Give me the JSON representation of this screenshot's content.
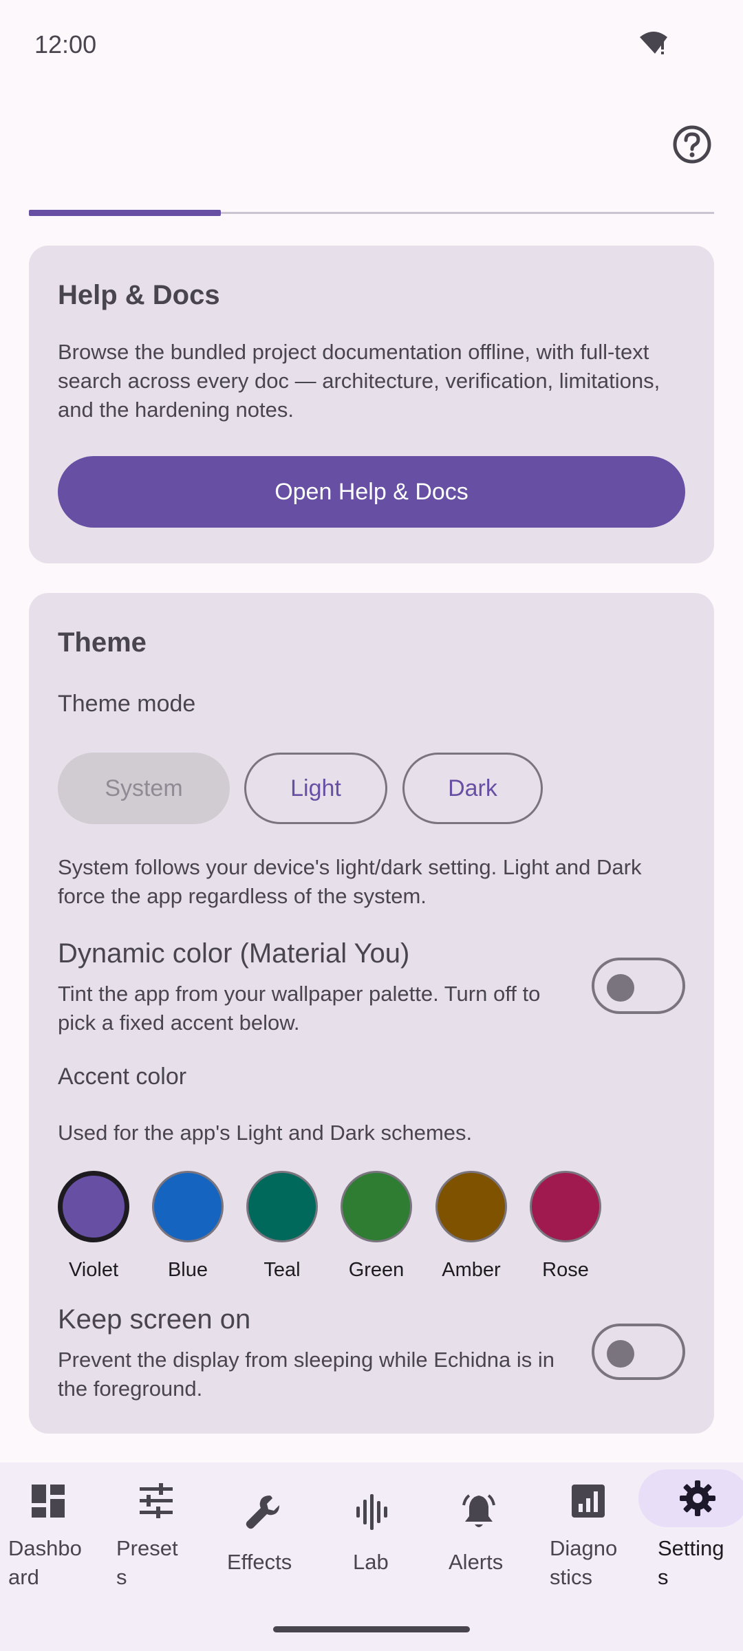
{
  "status_bar": {
    "time": "12:00"
  },
  "progress": {
    "value": 0.28
  },
  "help_card": {
    "title": "Help & Docs",
    "description": "Browse the bundled project documentation offline, with full-text search across every doc — architecture, verification, limitations, and the hardening notes.",
    "button_label": "Open Help & Docs"
  },
  "theme_card": {
    "title": "Theme",
    "mode_label": "Theme mode",
    "modes": [
      "System",
      "Light",
      "Dark"
    ],
    "selected_mode": "System",
    "mode_description": "System follows your device's light/dark setting. Light and Dark force the app regardless of the system.",
    "dynamic_color": {
      "title": "Dynamic color (Material You)",
      "description": "Tint the app from your wallpaper palette. Turn off to pick a fixed accent below.",
      "enabled": false
    },
    "accent": {
      "title": "Accent color",
      "description": "Used for the app's Light and Dark schemes.",
      "selected": "Violet",
      "options": [
        {
          "name": "Violet",
          "color": "#6750a4"
        },
        {
          "name": "Blue",
          "color": "#1565c0"
        },
        {
          "name": "Teal",
          "color": "#00695c"
        },
        {
          "name": "Green",
          "color": "#2e7d32"
        },
        {
          "name": "Amber",
          "color": "#7f5200"
        },
        {
          "name": "Rose",
          "color": "#a01a50"
        }
      ]
    },
    "keep_screen_on": {
      "title": "Keep screen on",
      "description": "Prevent the display from sleeping while Echidna is in the foreground.",
      "enabled": false
    }
  },
  "bottom_nav": {
    "items": [
      {
        "label_line1": "Dashbo",
        "label_line2": "ard",
        "icon": "dashboard-icon"
      },
      {
        "label_line1": "Preset",
        "label_line2": "s",
        "icon": "tune-icon"
      },
      {
        "label_line1": "Effects",
        "label_line2": "",
        "icon": "wrench-icon"
      },
      {
        "label_line1": "Lab",
        "label_line2": "",
        "icon": "waveform-icon"
      },
      {
        "label_line1": "Alerts",
        "label_line2": "",
        "icon": "bell-icon"
      },
      {
        "label_line1": "Diagno",
        "label_line2": "stics",
        "icon": "chart-icon"
      },
      {
        "label_line1": "Setting",
        "label_line2": "s",
        "icon": "gear-icon"
      }
    ],
    "active": "Settings"
  },
  "colors": {
    "primary": "#6750a4",
    "card_bg": "#e7e0ea",
    "background": "#fdf8fb"
  }
}
